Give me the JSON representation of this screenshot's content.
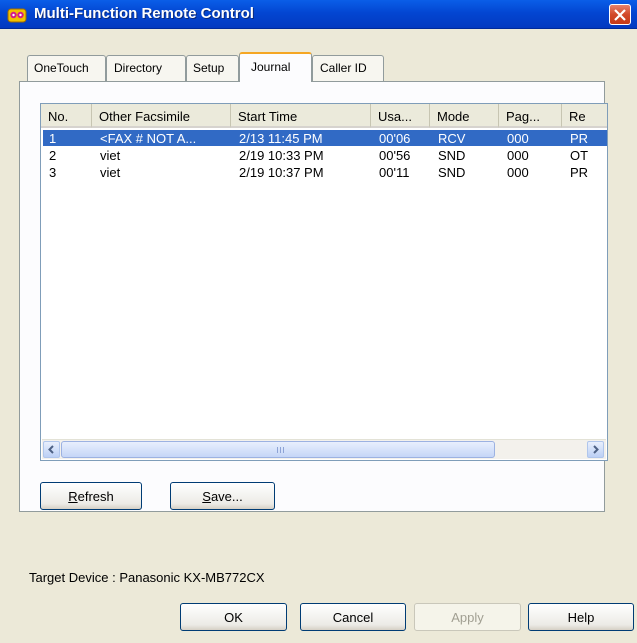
{
  "window": {
    "title": "Multi-Function Remote Control",
    "icon": "app-icon"
  },
  "tabs": [
    {
      "label": "OneTouch",
      "active": false
    },
    {
      "label": "Directory",
      "active": false
    },
    {
      "label": "Setup",
      "active": false
    },
    {
      "label": "Journal",
      "active": true
    },
    {
      "label": "Caller ID",
      "active": false
    }
  ],
  "journal": {
    "columns": [
      "No.",
      "Other Facsimile",
      "Start Time",
      "Usa...",
      "Mode",
      "Pag...",
      "Re"
    ],
    "rows": [
      {
        "no": "1",
        "other": "<FAX # NOT A...",
        "start": "2/13 11:45 PM",
        "usage": "00'06",
        "mode": "RCV",
        "pages": "000",
        "result": "PR",
        "selected": true
      },
      {
        "no": "2",
        "other": "viet",
        "start": "2/19 10:33 PM",
        "usage": "00'56",
        "mode": "SND",
        "pages": "000",
        "result": "OT",
        "selected": false
      },
      {
        "no": "3",
        "other": "viet",
        "start": "2/19 10:37 PM",
        "usage": "00'11",
        "mode": "SND",
        "pages": "000",
        "result": "PR",
        "selected": false
      }
    ]
  },
  "buttons": {
    "refresh": {
      "label": "Refresh",
      "mnemonic": "R",
      "rest": "efresh"
    },
    "save": {
      "label": "Save...",
      "mnemonic": "S",
      "rest": "ave..."
    },
    "ok": "OK",
    "cancel": "Cancel",
    "apply": "Apply",
    "help": "Help"
  },
  "target_device": "Target Device : Panasonic KX-MB772CX",
  "colors": {
    "title_bar": "#0346d2",
    "selection": "#316ac5",
    "active_tab_accent": "#f5a623",
    "close_button": "#d2492a"
  }
}
